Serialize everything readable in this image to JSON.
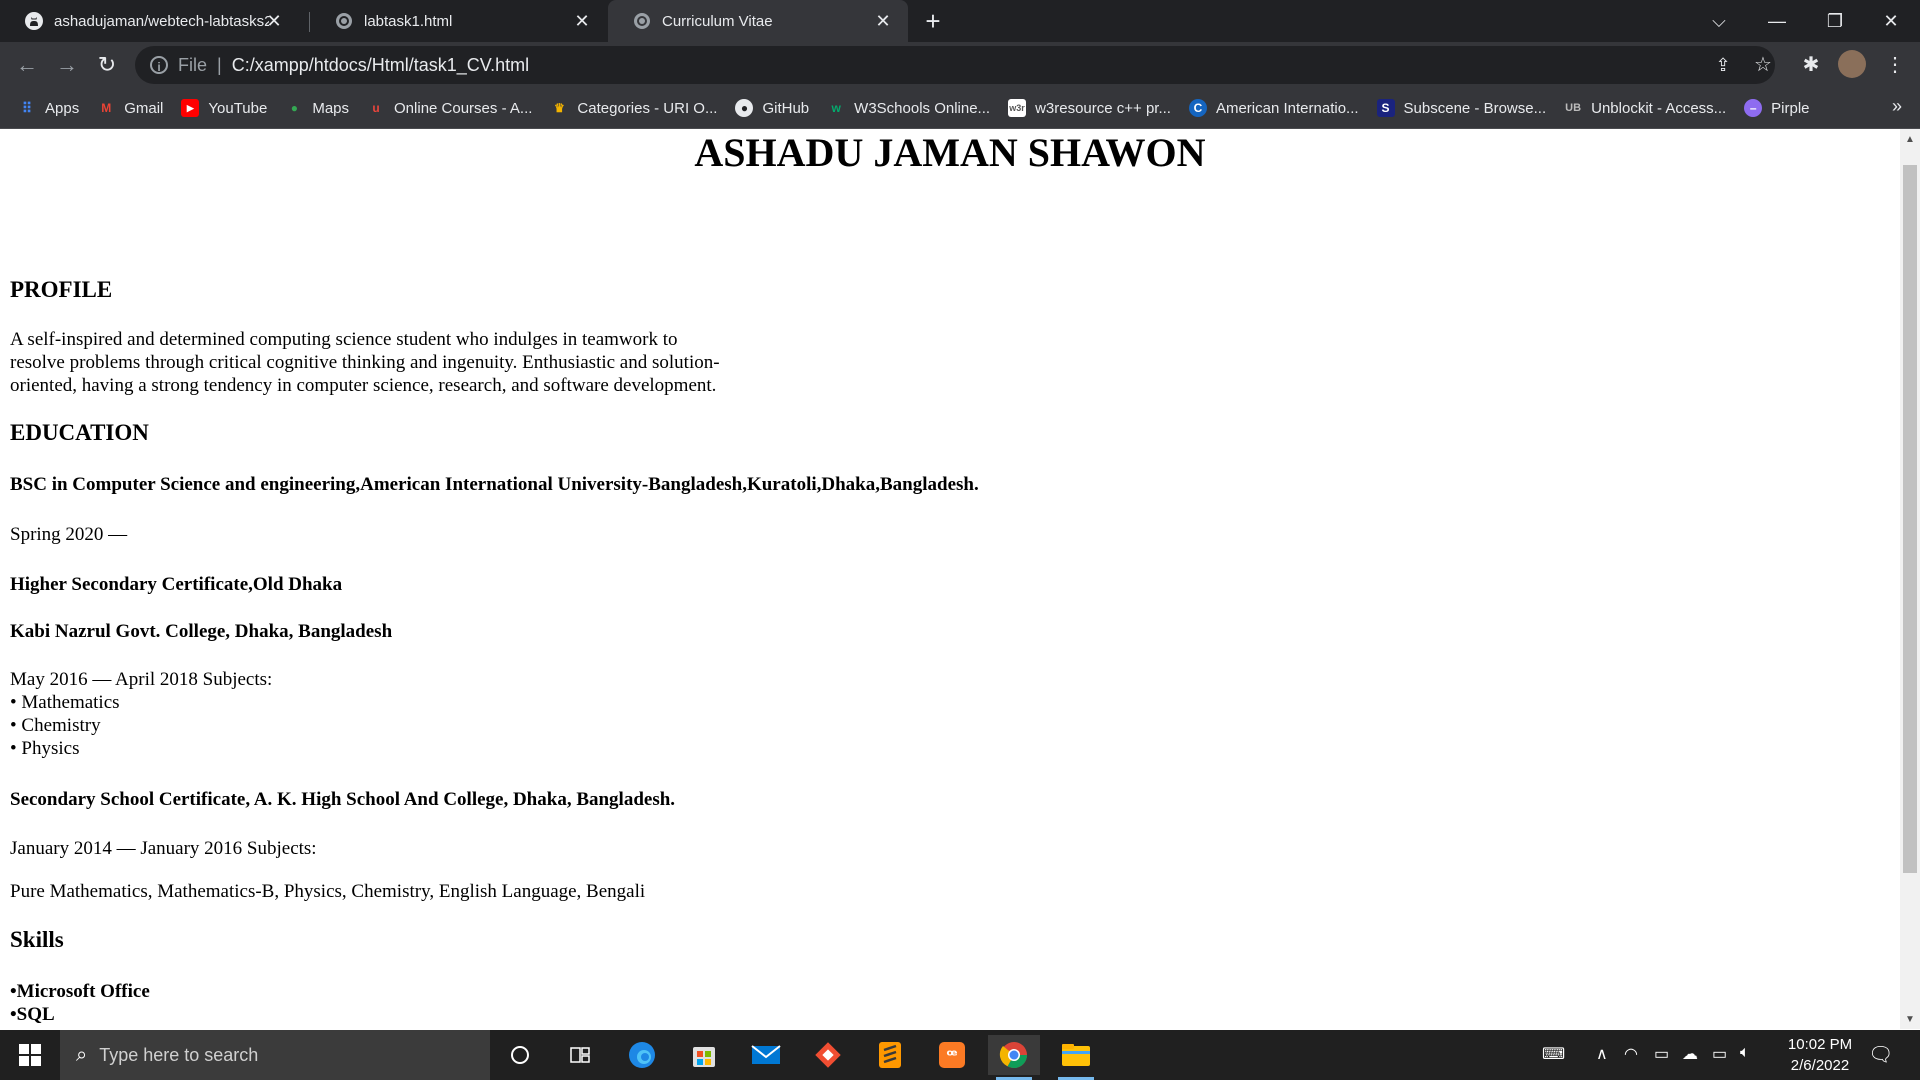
{
  "browser": {
    "tabs": [
      {
        "title": "ashadujaman/webtech-labtasks2",
        "favicon": "github-icon"
      },
      {
        "title": "labtask1.html",
        "favicon": "globe-icon"
      },
      {
        "title": "Curriculum Vitae",
        "favicon": "globe-icon",
        "active": true
      }
    ],
    "address": {
      "scheme": "File",
      "url": "C:/xampp/htdocs/Html/task1_CV.html"
    },
    "bookmarks": [
      {
        "label": "Apps",
        "icon": "apps-grid-icon"
      },
      {
        "label": "Gmail",
        "icon": "gmail-icon"
      },
      {
        "label": "YouTube",
        "icon": "youtube-icon"
      },
      {
        "label": "Maps",
        "icon": "maps-icon"
      },
      {
        "label": "Online Courses - A...",
        "icon": "courses-icon"
      },
      {
        "label": "Categories - URI O...",
        "icon": "trophy-icon"
      },
      {
        "label": "GitHub",
        "icon": "github-icon"
      },
      {
        "label": "W3Schools Online...",
        "icon": "w3schools-icon"
      },
      {
        "label": "w3resource c++ pr...",
        "icon": "w3resource-icon"
      },
      {
        "label": "American Internatio...",
        "icon": "aiub-icon"
      },
      {
        "label": "Subscene - Browse...",
        "icon": "subscene-icon"
      },
      {
        "label": "Unblockit - Access...",
        "icon": "unblockit-icon"
      },
      {
        "label": "Pirple",
        "icon": "pirple-icon"
      }
    ],
    "more_bookmarks": "»"
  },
  "cv": {
    "name": "ASHADU JAMAN SHAWON",
    "profile_heading": "PROFILE",
    "profile_lines": [
      "A self-inspired and determined computing science student who indulges in teamwork to",
      "resolve problems through critical cognitive thinking and ingenuity. Enthusiastic and solution-",
      "oriented, having a strong tendency in computer science, research, and software development."
    ],
    "education_heading": "EDUCATION",
    "bsc": "BSC in Computer Science and engineering,American International University-Bangladesh,Kuratoli,Dhaka,Bangladesh.",
    "bsc_period": "Spring 2020 —",
    "hsc": "Higher Secondary Certificate,Old Dhaka",
    "hsc_college": "Kabi Nazrul Govt. College, Dhaka, Bangladesh",
    "hsc_period": "May 2016 — April 2018 Subjects:",
    "hsc_subjects": [
      "• Mathematics",
      "• Chemistry",
      "• Physics"
    ],
    "ssc": "Secondary School Certificate, A. K. High School And College, Dhaka, Bangladesh.",
    "ssc_period": "January 2014 — January 2016 Subjects:",
    "ssc_subjects": "Pure Mathematics, Mathematics-B, Physics, Chemistry, English Language, Bengali",
    "skills_heading": "Skills",
    "skills": [
      "•Microsoft Office",
      "•SQL"
    ]
  },
  "taskbar": {
    "search_placeholder": "Type here to search",
    "time": "10:02 PM",
    "date": "2/6/2022"
  }
}
